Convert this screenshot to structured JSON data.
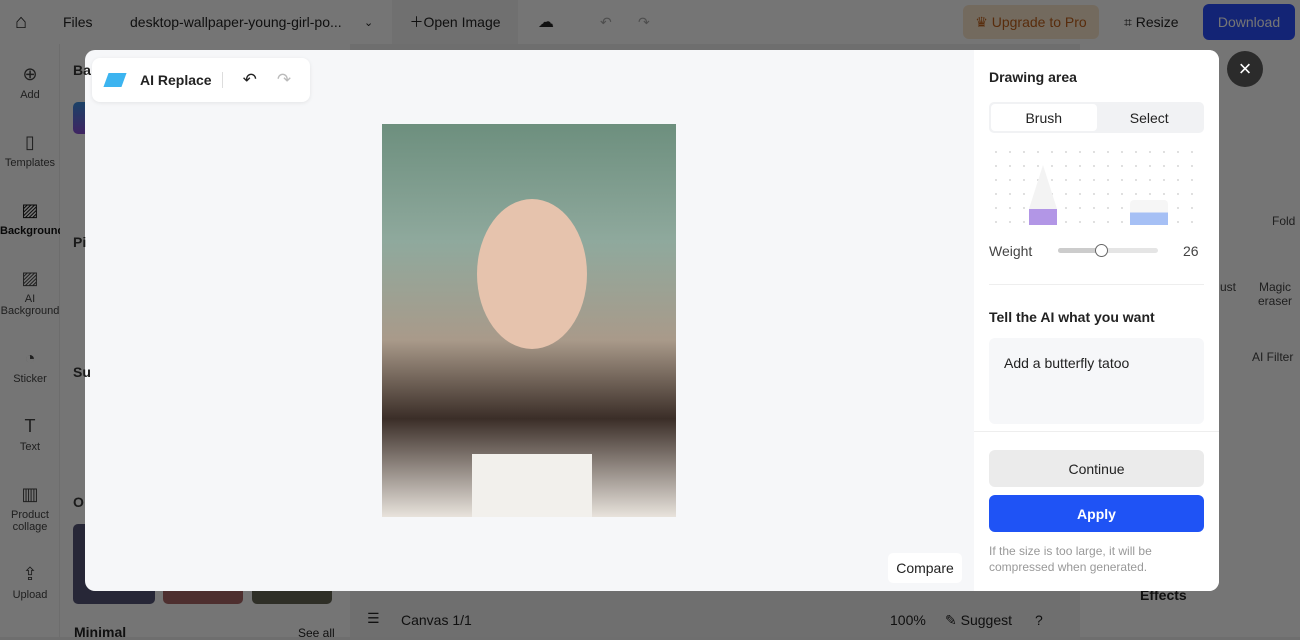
{
  "topbar": {
    "files": "Files",
    "filename": "desktop-wallpaper-young-girl-po...",
    "open_image": "Open Image",
    "upgrade": "Upgrade to Pro",
    "resize": "Resize",
    "download": "Download"
  },
  "sidebar": {
    "items": [
      {
        "label": "Add",
        "icon": "plus-circle-icon"
      },
      {
        "label": "Templates",
        "icon": "templates-icon"
      },
      {
        "label": "Background",
        "icon": "background-icon"
      },
      {
        "label": "AI Background",
        "icon": "ai-background-icon"
      },
      {
        "label": "Sticker",
        "icon": "sticker-icon"
      },
      {
        "label": "Text",
        "icon": "text-icon"
      },
      {
        "label": "Product collage",
        "icon": "collage-icon"
      },
      {
        "label": "Upload",
        "icon": "upload-icon"
      }
    ]
  },
  "panel": {
    "section_initials": [
      "Ba",
      "Pi",
      "Su",
      "O"
    ],
    "minimal": "Minimal",
    "see_all": "See all"
  },
  "bottombar": {
    "canvas": "Canvas 1/1",
    "zoom": "100%",
    "suggest": "Suggest",
    "help": "?"
  },
  "right_panel": {
    "fold": "Fold",
    "tools": [
      "ust",
      "Magic eraser",
      "AI Filter"
    ],
    "effects": "Effects"
  },
  "modal": {
    "title": "AI Replace",
    "compare": "Compare",
    "drawing_area": "Drawing area",
    "modes": [
      "Brush",
      "Select"
    ],
    "active_mode": "Brush",
    "weight_label": "Weight",
    "weight_value": "26",
    "weight_fraction": 0.43,
    "prompt_label": "Tell the AI what you want",
    "prompt_value": "Add a butterfly tatoo",
    "continue": "Continue",
    "apply": "Apply",
    "note": "If the size is too large, it will be compressed when generated.",
    "accent": "#1f53f5"
  }
}
